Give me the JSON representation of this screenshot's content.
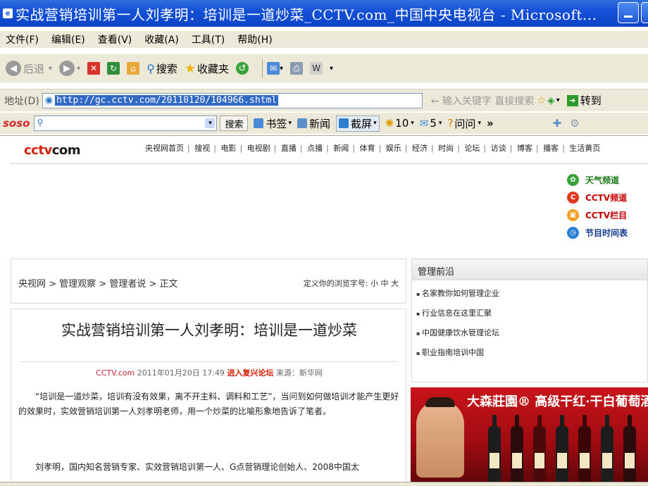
{
  "window": {
    "title": "实战营销培训第一人刘孝明：培训是一道炒菜_CCTV.com_中国中央电视台 - Microsoft..."
  },
  "menu": [
    "文件(F)",
    "编辑(E)",
    "查看(V)",
    "收藏(A)",
    "工具(T)",
    "帮助(H)"
  ],
  "toolbar": {
    "back": "后退",
    "search": "搜索",
    "favorites": "收藏夹"
  },
  "address": {
    "label": "地址(D)",
    "url": "http://gc.cctv.com/20110120/104966.shtml",
    "search_hint": "← 输入关键字 直接搜索",
    "go": "转到"
  },
  "soso": {
    "logo": "soso",
    "search_button": "搜索",
    "bookmarks": "书签",
    "news": "新闻",
    "screenshot": "截屏",
    "count1": "10",
    "count2": "5",
    "ask": "问问",
    "more": "»"
  },
  "page": {
    "logo_main": "cctv",
    "logo_suffix": "com",
    "topnav": [
      "央视网首页",
      "搜视",
      "电影",
      "电视剧",
      "直播",
      "点播",
      "新闻",
      "体育",
      "娱乐",
      "经济",
      "时尚",
      "论坛",
      "访谈",
      "博客",
      "播客",
      "生活黄页"
    ],
    "channels": [
      {
        "label": "天气频道",
        "color": "#3aa23a",
        "text_color": "#1a7a1a"
      },
      {
        "label": "CCTV频道",
        "color": "#e03a1e",
        "text_color": "#c40000"
      },
      {
        "label": "CCTV栏目",
        "color": "#f0a020",
        "text_color": "#c40000"
      },
      {
        "label": "节目时间表",
        "color": "#2a7fd4",
        "text_color": "#103a8a"
      }
    ],
    "breadcrumb": "央视网 > 管理观察 > 管理者说 > 正文",
    "font_size_control": "定义你的浏览字号: 小 中 大",
    "article": {
      "title": "实战营销培训第一人刘孝明：培训是一道炒菜",
      "site": "CCTV.com",
      "date": "2011年01月20日 17:49",
      "forum_link": "进入复兴论坛",
      "source": "来源：新华网",
      "paragraph1": "“培训是一道炒菜，培训有没有效果，离不开主料、调料和工艺”，当问到如何做培训才能产生更好的效果时，实效营销培训第一人刘孝明老师，用一个炒菜的比喻形象地告诉了笔者。",
      "paragraph2": "刘孝明，国内知名营销专家、实效营销培训第一人、G点营销理论创始人、2008中国太"
    },
    "sidebar": {
      "heading": "管理前沿",
      "items": [
        "名家教你如何管理企业",
        "行业信息在这里汇聚",
        "中国健康饮水管理论坛",
        "职业指南培训中国"
      ]
    },
    "ad": {
      "text": "大森莊園® 高级干红·干白葡萄酒"
    }
  }
}
